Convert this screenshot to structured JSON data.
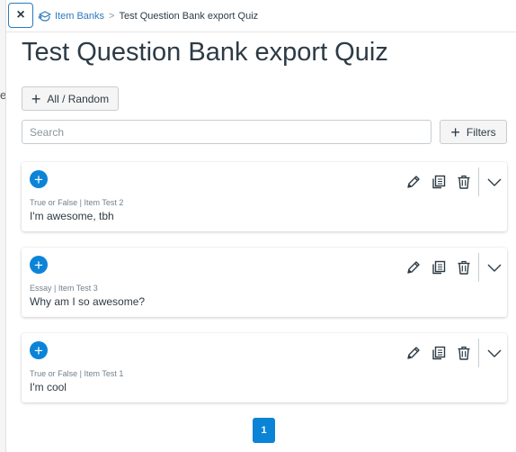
{
  "breadcrumb": {
    "root_label": "Item Banks",
    "separator": ">",
    "current": "Test Question Bank export Quiz"
  },
  "page": {
    "title": "Test Question Bank export Quiz",
    "close_label": "×",
    "left_edge_char": "e"
  },
  "toolbar": {
    "add_label": "All / Random",
    "filters_label": "Filters",
    "search_placeholder": "Search",
    "search_value": ""
  },
  "questions": [
    {
      "meta": "True or False | Item Test 2",
      "text": "I'm awesome, tbh"
    },
    {
      "meta": "Essay | Item Test 3",
      "text": "Why am I so awesome?"
    },
    {
      "meta": "True or False | Item Test 1",
      "text": "I'm cool"
    }
  ],
  "pagination": {
    "current_page": "1"
  },
  "icons": {
    "close": "close-icon",
    "breadcrumb": "item-bank-icon",
    "add": "plus-icon",
    "edit": "pencil-icon",
    "copy": "copy-icon",
    "delete": "trash-icon",
    "expand": "chevron-down-icon"
  },
  "colors": {
    "accent": "#0b84d8",
    "link": "#2b7abc",
    "text": "#2d3b45",
    "muted": "#73818c"
  }
}
